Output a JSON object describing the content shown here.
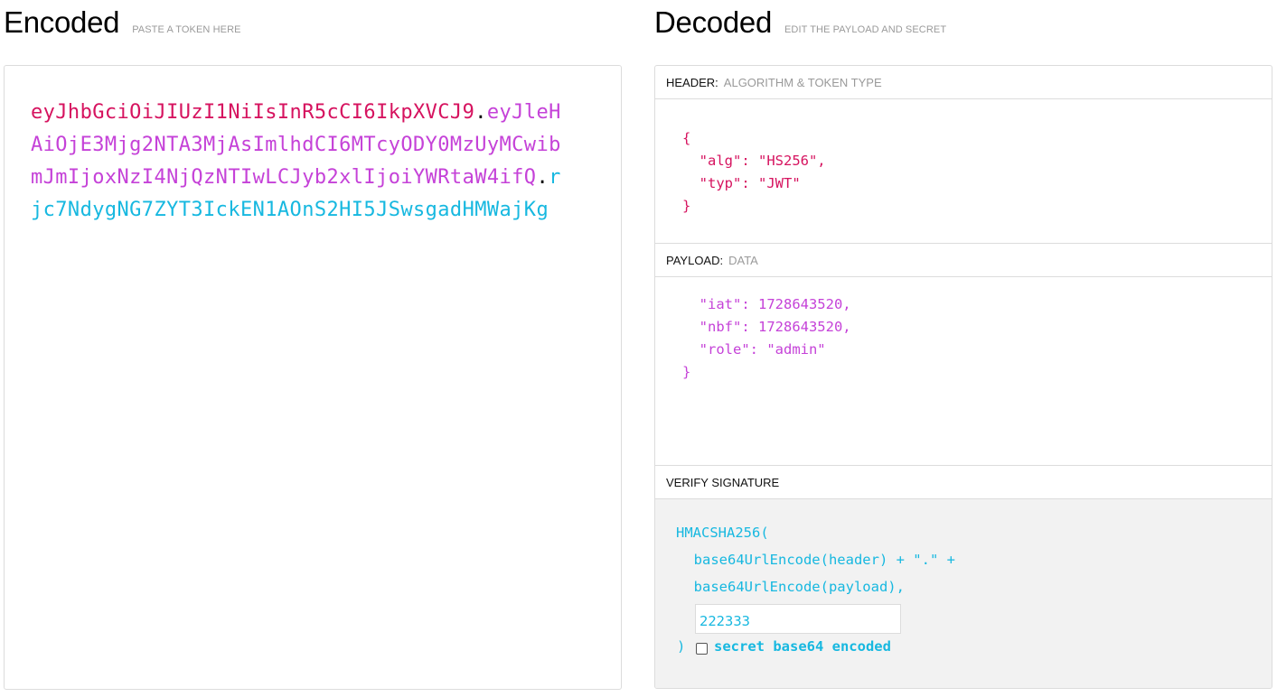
{
  "encoded": {
    "title": "Encoded",
    "subtitle": "PASTE A TOKEN HERE",
    "token": {
      "header": "eyJhbGciOiJIUzI1NiIsInR5cCI6IkpXVCJ9",
      "payload": "eyJleHAiOjE3Mjg2NTA3MjAsImlhdCI6MTcyODY0MzUyMCwibmJmIjoxNzI4NjQzNTIwLCJyb2xlIjoiYWRtaW4ifQ",
      "signature": "rjc7NdygNG7ZYT3IckEN1AOnS2HI5JSwsgadHMWajKg",
      "dot": "."
    }
  },
  "decoded": {
    "title": "Decoded",
    "subtitle": "EDIT THE PAYLOAD AND SECRET",
    "header": {
      "label": "HEADER:",
      "sublabel": "ALGORITHM & TOKEN TYPE",
      "json": "{\n  \"alg\": \"HS256\",\n  \"typ\": \"JWT\"\n}"
    },
    "payload": {
      "label": "PAYLOAD:",
      "sublabel": "DATA",
      "json": "  \"iat\": 1728643520,\n  \"nbf\": 1728643520,\n  \"role\": \"admin\"\n}"
    },
    "verify": {
      "label": "VERIFY SIGNATURE",
      "line1": "HMACSHA256(",
      "line2": "  base64UrlEncode(header) + \".\" +",
      "line3": "  base64UrlEncode(payload),",
      "secret_value": "222333",
      "close": ")",
      "checkbox_label": "secret base64 encoded",
      "checkbox_checked": false
    }
  },
  "colors": {
    "header": "#d6135f",
    "payload": "#c542d8",
    "signature": "#17b8e0"
  }
}
